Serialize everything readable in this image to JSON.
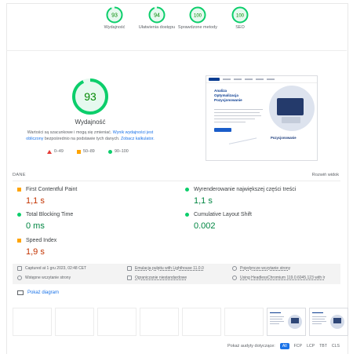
{
  "scores": [
    {
      "label": "Wydajność",
      "score": "93"
    },
    {
      "label": "Ułatwienia dostępu",
      "score": "94"
    },
    {
      "label": "Sprawdzone metody",
      "score": "100"
    },
    {
      "label": "SEO",
      "score": "100"
    }
  ],
  "colors": {
    "good": "#0cce6b",
    "good_text": "#008800",
    "average": "#ffa400",
    "fail": "#e53935",
    "link": "#1a73e8"
  },
  "performance": {
    "score": "93",
    "title": "Wydajność",
    "desc_1": "Wartości są szacunkowe i mogą się zmieniać. ",
    "desc_link1": "Wynik wydajności jest obliczony",
    "desc_2": " bezpośrednio na podstawie tych danych. ",
    "desc_link2": "Zobacz kalkulator.",
    "legend": [
      "0–49",
      "50–89",
      "90–100"
    ]
  },
  "screenshot": {
    "hero_title": "Analiza\nOptymalizacja\nPozycjonowanie",
    "section_title": "Pozycjonowanie"
  },
  "data_section": {
    "title": "DANE",
    "expand": "Rozwiń widok"
  },
  "metrics": [
    {
      "label": "First Contentful Paint",
      "value": "1,1 s",
      "status": "average"
    },
    {
      "label": "Wyrenderowanie największej części treści",
      "value": "1,1 s",
      "status": "good"
    },
    {
      "label": "Total Blocking Time",
      "value": "0 ms",
      "status": "good"
    },
    {
      "label": "Cumulative Layout Shift",
      "value": "0.002",
      "status": "good"
    },
    {
      "label": "Speed Index",
      "value": "1,9 s",
      "status": "average"
    }
  ],
  "runtime": {
    "captured": "Captured at 1 gru 2023, 02:48 CET",
    "emulation": "Emulacja pulpitu with Lighthouse 11.0.0",
    "session": "Pojedyncze wczytanie strony",
    "initial": "Wstępne wczytanie strony",
    "throttling": "Ograniczanie niestandardowe",
    "browser": "Using HeadlessChromium 119.0.6045.123 with lr"
  },
  "diagram_button": "Pokaż diagram",
  "audits": {
    "label": "Pokaż audyty dotyczące:",
    "filters": [
      "All",
      "FCP",
      "LCP",
      "TBT",
      "CLS"
    ]
  }
}
